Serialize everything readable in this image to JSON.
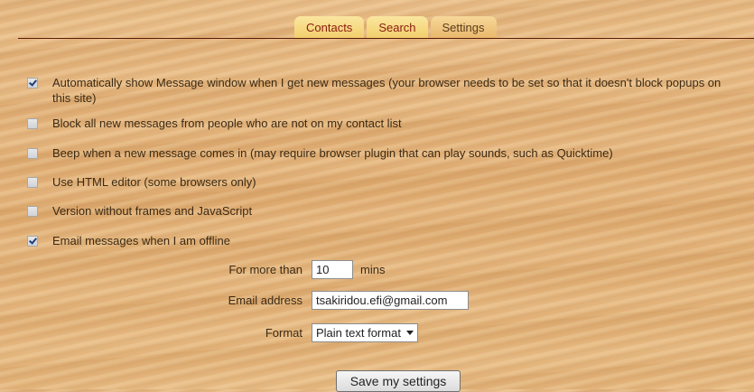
{
  "tabs": [
    {
      "label": "Contacts",
      "active": false
    },
    {
      "label": "Search",
      "active": false
    },
    {
      "label": "Settings",
      "active": true
    }
  ],
  "options": [
    {
      "checked": true,
      "label": "Automatically show Message window when I get new messages (your browser needs to be set so that it doesn't block popups on this site)"
    },
    {
      "checked": false,
      "label": "Block all new messages from people who are not on my contact list"
    },
    {
      "checked": false,
      "label": "Beep when a new message comes in (may require browser plugin that can play sounds, such as Quicktime)"
    },
    {
      "checked": false,
      "label": "Use HTML editor (some browsers only)"
    },
    {
      "checked": false,
      "label": "Version without frames and JavaScript"
    },
    {
      "checked": true,
      "label": "Email messages when I am offline"
    }
  ],
  "offline": {
    "for_more_than_label": "For more than",
    "minutes_value": "10",
    "minutes_unit": "mins",
    "email_label": "Email address",
    "email_value": "tsakiridou.efi@gmail.com",
    "format_label": "Format",
    "format_value": "Plain text format"
  },
  "save_label": "Save my settings",
  "colors": {
    "tab_text": "#8a1b12",
    "rule": "#5b1a0a",
    "background": "#e3b47c"
  }
}
